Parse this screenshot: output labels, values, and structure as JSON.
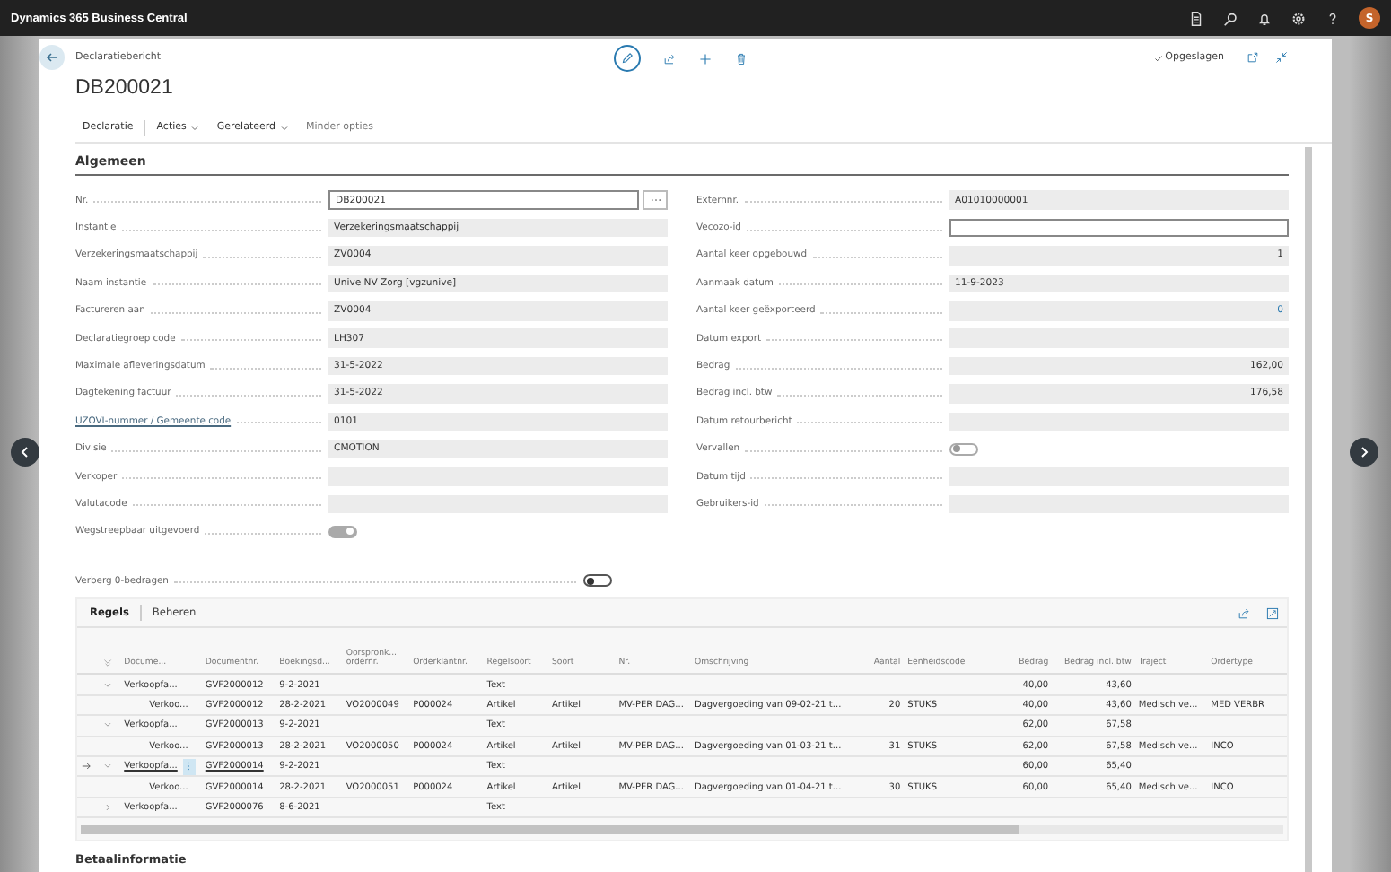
{
  "app": {
    "title": "Dynamics 365 Business Central",
    "user_initial": "S"
  },
  "page": {
    "breadcrumb": "Declaratiebericht",
    "title": "DB200021",
    "status": "Opgeslagen"
  },
  "actions": [
    {
      "label": "Declaratie",
      "dropdown": false
    },
    {
      "label": "Acties",
      "dropdown": true
    },
    {
      "label": "Gerelateerd",
      "dropdown": true
    },
    {
      "label": "Minder opties",
      "dropdown": false
    }
  ],
  "general": {
    "title": "Algemeen",
    "left": [
      {
        "label": "Nr.",
        "kind": "lookup",
        "value": "DB200021"
      },
      {
        "label": "Instantie",
        "kind": "text",
        "value": "Verzekeringsmaatschappij"
      },
      {
        "label": "Verzekeringsmaatschappij",
        "kind": "text",
        "value": "ZV0004"
      },
      {
        "label": "Naam instantie",
        "kind": "text",
        "value": "Unive NV Zorg [vgzunive]"
      },
      {
        "label": "Factureren aan",
        "kind": "text",
        "value": "ZV0004"
      },
      {
        "label": "Declaratiegroep code",
        "kind": "text",
        "value": "LH307"
      },
      {
        "label": "Maximale afleveringsdatum",
        "kind": "text",
        "value": "31-5-2022"
      },
      {
        "label": "Dagtekening factuur",
        "kind": "text",
        "value": "31-5-2022"
      },
      {
        "label": "UZOVI-nummer / Gemeente code",
        "kind": "text",
        "value": "0101",
        "label_link": true
      },
      {
        "label": "Divisie",
        "kind": "text",
        "value": "CMOTION"
      },
      {
        "label": "Verkoper",
        "kind": "text"
      },
      {
        "label": "Valutacode",
        "kind": "text"
      },
      {
        "label": "Wegstreepbaar uitgevoerd",
        "kind": "toggle",
        "on": true
      }
    ],
    "right": [
      {
        "label": "Externnr.",
        "kind": "text",
        "value": "A01010000001"
      },
      {
        "label": "Vecozo-id",
        "kind": "input"
      },
      {
        "label": "Aantal keer opgebouwd",
        "kind": "number",
        "value": "1"
      },
      {
        "label": "Aanmaak datum",
        "kind": "text",
        "value": "11-9-2023"
      },
      {
        "label": "Aantal keer geëxporteerd",
        "kind": "number",
        "value": "0",
        "link": true
      },
      {
        "label": "Datum export",
        "kind": "text"
      },
      {
        "label": "Bedrag",
        "kind": "number",
        "value": "162,00"
      },
      {
        "label": "Bedrag incl. btw",
        "kind": "number",
        "value": "176,58"
      },
      {
        "label": "Datum retourbericht",
        "kind": "text"
      },
      {
        "label": "Vervallen",
        "kind": "toggle",
        "on": false
      },
      {
        "label": "Datum tijd",
        "kind": "text"
      },
      {
        "label": "Gebruikers-id",
        "kind": "text"
      }
    ]
  },
  "hide_zero": {
    "label": "Verberg 0-bedragen",
    "on": false
  },
  "lines": {
    "tabs": [
      {
        "label": "Regels",
        "selected": true
      },
      {
        "label": "Beheren",
        "selected": false
      }
    ],
    "columns": [
      {
        "label": "Docume...",
        "kind": "text"
      },
      {
        "label": "Documentnr.",
        "kind": "text"
      },
      {
        "label": "Boekingsd...",
        "kind": "text"
      },
      {
        "label": "Oorspronk... ordernr.",
        "kind": "text"
      },
      {
        "label": "Orderklantnr.",
        "kind": "text"
      },
      {
        "label": "Regelsoort",
        "kind": "text"
      },
      {
        "label": "Soort",
        "kind": "text"
      },
      {
        "label": "Nr.",
        "kind": "text"
      },
      {
        "label": "Omschrijving",
        "kind": "text"
      },
      {
        "label": "Aantal",
        "kind": "number"
      },
      {
        "label": "Eenheidscode",
        "kind": "text"
      },
      {
        "label": "Bedrag",
        "kind": "number"
      },
      {
        "label": "Bedrag incl. btw",
        "kind": "number"
      },
      {
        "label": "Traject",
        "kind": "text"
      },
      {
        "label": "Ordertype",
        "kind": "text"
      }
    ],
    "rows": [
      {
        "selected": false,
        "expanded": true,
        "cells": [
          "Verkoopfa...",
          "GVF2000012",
          "9-2-2021",
          null,
          null,
          "Text",
          null,
          null,
          null,
          null,
          null,
          "40,00",
          "43,60",
          null,
          null
        ],
        "children": [
          {
            "selected": false,
            "cells": [
              "Verkoo...",
              "GVF2000012",
              "28-2-2021",
              "VO2000049",
              "P000024",
              "Artikel",
              "Artikel",
              "MV-PER DAG...",
              "Dagvergoeding van 09-02-21 t...",
              "20",
              "STUKS",
              "40,00",
              "43,60",
              "Medisch ve...",
              "MED VERBR"
            ]
          }
        ]
      },
      {
        "selected": false,
        "expanded": true,
        "cells": [
          "Verkoopfa...",
          "GVF2000013",
          "9-2-2021",
          null,
          null,
          "Text",
          null,
          null,
          null,
          null,
          null,
          "62,00",
          "67,58",
          null,
          null
        ],
        "children": [
          {
            "selected": false,
            "cells": [
              "Verkoo...",
              "GVF2000013",
              "28-2-2021",
              "VO2000050",
              "P000024",
              "Artikel",
              "Artikel",
              "MV-PER DAG...",
              "Dagvergoeding van 01-03-21 t...",
              "31",
              "STUKS",
              "62,00",
              "67,58",
              "Medisch ve...",
              "INCO"
            ]
          }
        ]
      },
      {
        "selected": true,
        "expanded": true,
        "cells": [
          "Verkoopfa...",
          "GVF2000014",
          "9-2-2021",
          null,
          null,
          "Text",
          null,
          null,
          null,
          null,
          null,
          "60,00",
          "65,40",
          null,
          null
        ],
        "children": [
          {
            "selected": false,
            "cells": [
              "Verkoo...",
              "GVF2000014",
              "28-2-2021",
              "VO2000051",
              "P000024",
              "Artikel",
              "Artikel",
              "MV-PER DAG...",
              "Dagvergoeding van 01-04-21 t...",
              "30",
              "STUKS",
              "60,00",
              "65,40",
              "Medisch ve...",
              "INCO"
            ]
          }
        ]
      },
      {
        "selected": false,
        "expanded": false,
        "cells": [
          "Verkoopfa...",
          "GVF2000076",
          "8-6-2021",
          null,
          null,
          "Text",
          null,
          null,
          null,
          null,
          null,
          null,
          null,
          null,
          null
        ]
      }
    ]
  },
  "next_section": "Betaalinformatie"
}
